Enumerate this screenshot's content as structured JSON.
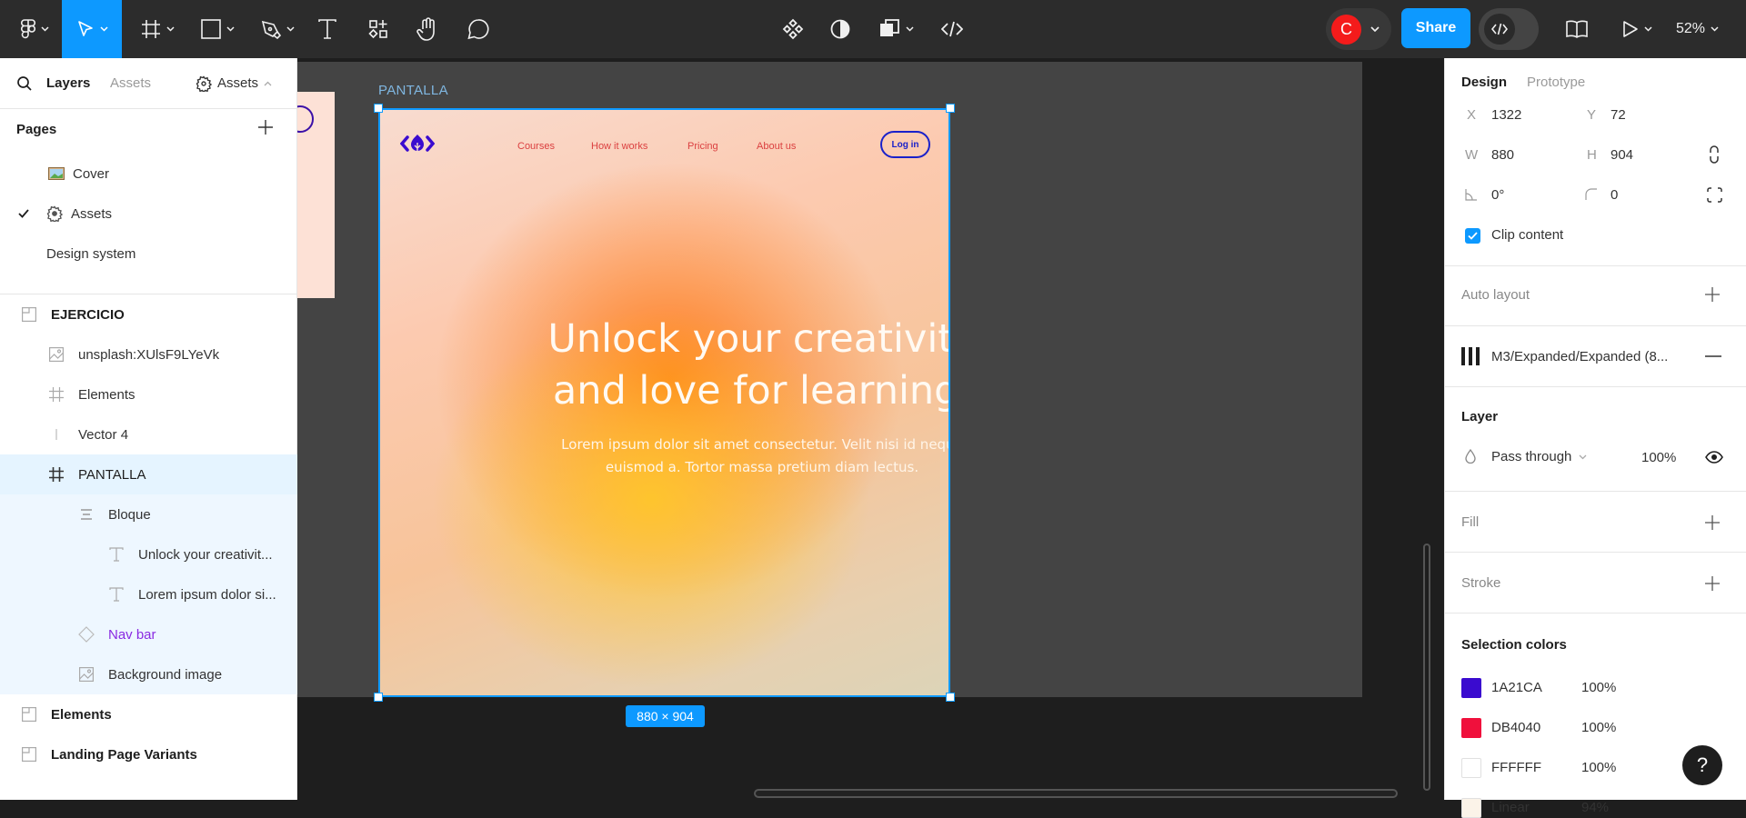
{
  "toolbar": {
    "tools": [
      {
        "name": "main-menu",
        "icon": "figma-logo-icon",
        "has_dropdown": true
      },
      {
        "name": "move-tool",
        "icon": "cursor-arrow-icon",
        "has_dropdown": true,
        "active": true
      },
      {
        "name": "frame-tool",
        "icon": "frame-hash-icon",
        "has_dropdown": true
      },
      {
        "name": "shape-tool",
        "icon": "rectangle-icon",
        "has_dropdown": true
      },
      {
        "name": "pen-tool",
        "icon": "pen-nib-icon",
        "has_dropdown": true
      },
      {
        "name": "text-tool",
        "icon": "text-t-icon",
        "has_dropdown": false
      },
      {
        "name": "resources-tool",
        "icon": "resources-icon",
        "has_dropdown": false
      },
      {
        "name": "hand-tool",
        "icon": "hand-icon",
        "has_dropdown": false
      },
      {
        "name": "comment-tool",
        "icon": "comment-bubble-icon",
        "has_dropdown": false
      }
    ],
    "center_tools": [
      {
        "name": "component-tool",
        "icon": "component-diamonds-icon"
      },
      {
        "name": "mask-tool",
        "icon": "contrast-half-icon"
      },
      {
        "name": "boolean-tool",
        "icon": "boolean-shapes-icon"
      },
      {
        "name": "code-tool",
        "icon": "code-brackets-icon"
      }
    ],
    "avatar_initial": "C",
    "avatar_color": "#F41B1B",
    "share_label": "Share",
    "zoom_level": "52%"
  },
  "left_panel": {
    "tabs": {
      "layers": "Layers",
      "assets": "Assets"
    },
    "page_dropdown_label": "Assets",
    "pages_header": "Pages",
    "pages": [
      {
        "label": "Cover",
        "icon": "picture-emoji-icon",
        "current": false
      },
      {
        "label": "Assets",
        "icon": "gear-icon",
        "current": true
      },
      {
        "label": "Design system",
        "icon": "",
        "current": false
      }
    ],
    "layers": [
      {
        "label": "EJERCICIO",
        "icon": "section-icon",
        "level": 0,
        "bold": true
      },
      {
        "label": "unsplash:XUlsF9LYeVk",
        "icon": "image-icon",
        "level": 1
      },
      {
        "label": "Elements",
        "icon": "frame-hash-icon",
        "level": 1
      },
      {
        "label": "Vector 4",
        "icon": "vector-line-icon",
        "level": 1
      },
      {
        "label": "PANTALLA",
        "icon": "frame-hash-icon",
        "level": 1,
        "selected": true
      },
      {
        "label": "Bloque",
        "icon": "auto-layout-icon",
        "level": 2
      },
      {
        "label": "Unlock your creativit...",
        "icon": "text-t-icon",
        "level": 3
      },
      {
        "label": "Lorem ipsum dolor si...",
        "icon": "text-t-icon",
        "level": 3
      },
      {
        "label": "Nav bar",
        "icon": "instance-diamond-icon",
        "level": 2,
        "component": true
      },
      {
        "label": "Background image",
        "icon": "image-icon",
        "level": 2
      },
      {
        "label": "Elements",
        "icon": "section-icon",
        "level": 0,
        "bold": true
      },
      {
        "label": "Landing Page Variants",
        "icon": "section-icon",
        "level": 0,
        "bold": true
      }
    ]
  },
  "canvas": {
    "frame_name": "PANTALLA",
    "size_badge": "880 × 904",
    "frame_content": {
      "nav_links": [
        "Courses",
        "How it works",
        "Pricing",
        "About us"
      ],
      "login_label": "Log in",
      "hero_title_line1": "Unlock your creativity",
      "hero_title_line2": "and love for learning.",
      "hero_sub_line1": "Lorem ipsum dolor sit amet consectetur. Velit nisi id neque",
      "hero_sub_line2": "euismod a. Tortor massa pretium diam lectus."
    }
  },
  "right_panel": {
    "tabs": {
      "design": "Design",
      "prototype": "Prototype"
    },
    "x_label": "X",
    "x_value": "1322",
    "y_label": "Y",
    "y_value": "72",
    "w_label": "W",
    "w_value": "880",
    "h_label": "H",
    "h_value": "904",
    "rotation_value": "0°",
    "radius_value": "0",
    "clip_content_label": "Clip content",
    "clip_content_checked": true,
    "auto_layout_label": "Auto layout",
    "layout_grid_label": "M3/Expanded/Expanded (8...",
    "layer_header": "Layer",
    "blend_mode": "Pass through",
    "layer_opacity": "100%",
    "fill_label": "Fill",
    "stroke_label": "Stroke",
    "selection_colors_header": "Selection colors",
    "selection_colors": [
      {
        "hex": "1A21CA",
        "color": "#3A0BCF",
        "opacity": "100%"
      },
      {
        "hex": "DB4040",
        "color": "#F0103C",
        "opacity": "100%"
      },
      {
        "hex": "FFFFFF",
        "color": "#FFFFFF",
        "opacity": "100%"
      },
      {
        "hex": "Linear",
        "color": "#FBF3E8",
        "opacity": "94%"
      }
    ],
    "help_label": "?"
  }
}
